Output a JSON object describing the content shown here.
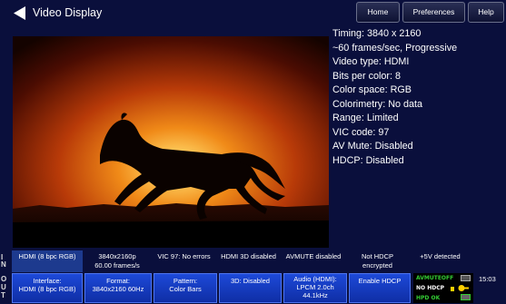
{
  "header": {
    "title": "Video Display",
    "tabs": {
      "home": "Home",
      "preferences": "Preferences",
      "help": "Help"
    }
  },
  "video_info": [
    "Timing: 3840 x 2160",
    "~60 frames/sec, Progressive",
    "Video type: HDMI",
    "Bits per color: 8",
    "Color space: RGB",
    "Colorimetry: No data",
    "Range: Limited",
    "VIC code: 97",
    "AV Mute: Disabled",
    "HDCP: Disabled"
  ],
  "status_bar": {
    "label": "IN",
    "cells": [
      "HDMI (8 bpc RGB)",
      "3840x2160p\n60.00 frames/s",
      "VIC 97: No errors",
      "HDMI 3D disabled",
      "AVMUTE disabled",
      "Not HDCP\nencrypted",
      "+5V detected"
    ]
  },
  "control_bar": {
    "label": "OUT",
    "buttons": [
      "Interface:\nHDMI (8 bpc RGB)",
      "Format:\n3840x2160 60Hz",
      "Pattern:\nColor Bars",
      "3D: Disabled",
      "Audio (HDMI):\nLPCM 2.0ch\n44.1kHz",
      "Enable HDCP"
    ],
    "hw_status": {
      "avmute": "AVMUTEOFF",
      "hdcp": "NO HDCP",
      "hpd": "HPD OK"
    },
    "time": "15:03"
  },
  "colors": {
    "background": "#0a0f3c",
    "button_blue": "#1d49d8",
    "status_green": "#33cc33",
    "status_yellow": "#ffd000"
  }
}
